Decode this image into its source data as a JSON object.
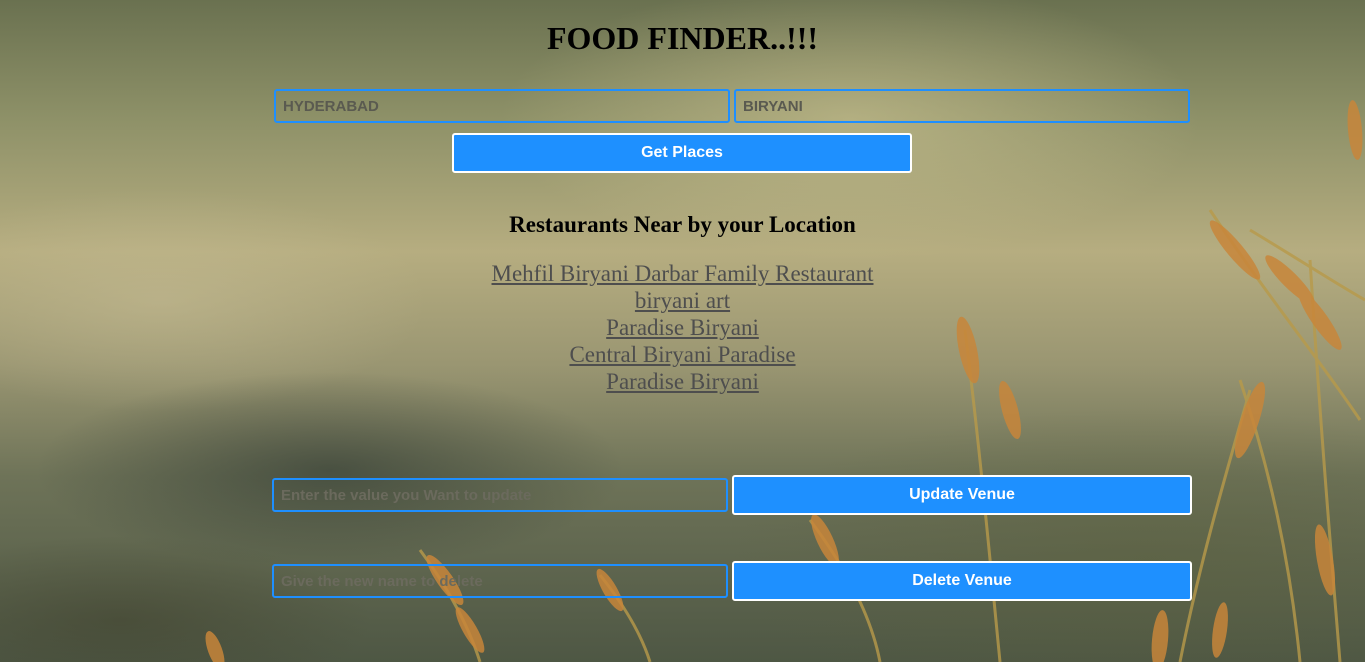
{
  "header": {
    "title": "FOOD FINDER..!!!"
  },
  "search": {
    "location_value": "HYDERABAD",
    "query_value": "BIRYANI",
    "submit_label": "Get Places"
  },
  "results": {
    "heading": "Restaurants Near by your Location",
    "items": [
      {
        "label": "Mehfil Biryani Darbar Family Restaurant"
      },
      {
        "label": "biryani art"
      },
      {
        "label": "Paradise Biryani"
      },
      {
        "label": "Central Biryani Paradise"
      },
      {
        "label": "Paradise Biryani"
      }
    ]
  },
  "update": {
    "placeholder": "Enter the value you Want to update",
    "button_label": "Update Venue"
  },
  "delete": {
    "placeholder": "Give the new name to delete",
    "button_label": "Delete Venue"
  },
  "theme": {
    "accent": "#1e90ff",
    "field_border": "#1e8fff",
    "link_color": "#4e4e4e",
    "heading_color": "#000000"
  }
}
